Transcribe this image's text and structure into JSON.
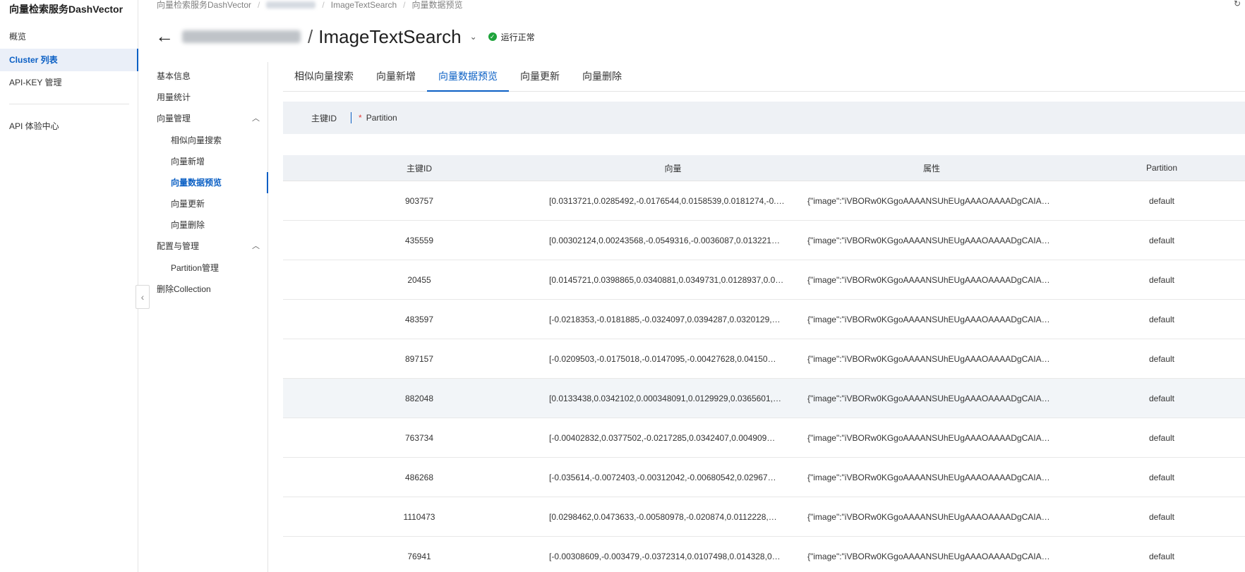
{
  "global_nav": {
    "brand": "向量检索服务DashVector",
    "items": [
      {
        "label": "概览",
        "active": false
      },
      {
        "label": "Cluster 列表",
        "active": true
      },
      {
        "label": "API-KEY 管理",
        "active": false
      },
      {
        "label": "API 体验中心",
        "active": false
      }
    ]
  },
  "breadcrumb": {
    "items": [
      "向量检索服务DashVector",
      "",
      "ImageTextSearch",
      "向量数据预览"
    ],
    "separator": "/"
  },
  "header": {
    "title": "ImageTextSearch",
    "separator": "/",
    "status_text": "运行正常",
    "status_color": "#1ea33b"
  },
  "sub_nav": {
    "items": [
      {
        "label": "基本信息",
        "level": 0
      },
      {
        "label": "用量统计",
        "level": 0
      },
      {
        "label": "向量管理",
        "level": 0,
        "expanded": true
      },
      {
        "label": "相似向量搜索",
        "level": 1
      },
      {
        "label": "向量新增",
        "level": 1
      },
      {
        "label": "向量数据预览",
        "level": 1,
        "active": true
      },
      {
        "label": "向量更新",
        "level": 1
      },
      {
        "label": "向量删除",
        "level": 1
      },
      {
        "label": "配置与管理",
        "level": 0,
        "expanded": true
      },
      {
        "label": "Partition管理",
        "level": 1
      },
      {
        "label": "删除Collection",
        "level": 0
      }
    ]
  },
  "tabs": [
    {
      "label": "相似向量搜索",
      "active": false
    },
    {
      "label": "向量新增",
      "active": false
    },
    {
      "label": "向量数据预览",
      "active": true
    },
    {
      "label": "向量更新",
      "active": false
    },
    {
      "label": "向量删除",
      "active": false
    }
  ],
  "filter": {
    "primary_key_label": "主键ID",
    "partition_required_mark": "*",
    "partition_label": "Partition"
  },
  "table": {
    "columns": [
      "主键ID",
      "向量",
      "属性",
      "Partition"
    ],
    "rows": [
      {
        "id": "903757",
        "vector": "[0.0313721,0.0285492,-0.0176544,0.0158539,0.0181274,-0.…",
        "attr": "{\"image\":\"iVBORw0KGgoAAAANSUhEUgAAAOAAAADgCAIA…",
        "partition": "default"
      },
      {
        "id": "435559",
        "vector": "[0.00302124,0.00243568,-0.0549316,-0.0036087,0.013221…",
        "attr": "{\"image\":\"iVBORw0KGgoAAAANSUhEUgAAAOAAAADgCAIA…",
        "partition": "default"
      },
      {
        "id": "20455",
        "vector": "[0.0145721,0.0398865,0.0340881,0.0349731,0.0128937,0.0…",
        "attr": "{\"image\":\"iVBORw0KGgoAAAANSUhEUgAAAOAAAADgCAIA…",
        "partition": "default"
      },
      {
        "id": "483597",
        "vector": "[-0.0218353,-0.0181885,-0.0324097,0.0394287,0.0320129,…",
        "attr": "{\"image\":\"iVBORw0KGgoAAAANSUhEUgAAAOAAAADgCAIA…",
        "partition": "default"
      },
      {
        "id": "897157",
        "vector": "[-0.0209503,-0.0175018,-0.0147095,-0.00427628,0.04150…",
        "attr": "{\"image\":\"iVBORw0KGgoAAAANSUhEUgAAAOAAAADgCAIA…",
        "partition": "default"
      },
      {
        "id": "882048",
        "vector": "[0.0133438,0.0342102,0.000348091,0.0129929,0.0365601,…",
        "attr": "{\"image\":\"iVBORw0KGgoAAAANSUhEUgAAAOAAAADgCAIA…",
        "partition": "default"
      },
      {
        "id": "763734",
        "vector": "[-0.00402832,0.0377502,-0.0217285,0.0342407,0.004909…",
        "attr": "{\"image\":\"iVBORw0KGgoAAAANSUhEUgAAAOAAAADgCAIA…",
        "partition": "default"
      },
      {
        "id": "486268",
        "vector": "[-0.035614,-0.0072403,-0.00312042,-0.00680542,0.02967…",
        "attr": "{\"image\":\"iVBORw0KGgoAAAANSUhEUgAAAOAAAADgCAIA…",
        "partition": "default"
      },
      {
        "id": "1110473",
        "vector": "[0.0298462,0.0473633,-0.00580978,-0.020874,0.0112228,…",
        "attr": "{\"image\":\"iVBORw0KGgoAAAANSUhEUgAAAOAAAADgCAIA…",
        "partition": "default"
      },
      {
        "id": "76941",
        "vector": "[-0.00308609,-0.003479,-0.0372314,0.0107498,0.014328,0…",
        "attr": "{\"image\":\"iVBORw0KGgoAAAANSUhEUgAAAOAAAADgCAIA…",
        "partition": "default"
      }
    ]
  },
  "accent_color": "#0a5fc4"
}
